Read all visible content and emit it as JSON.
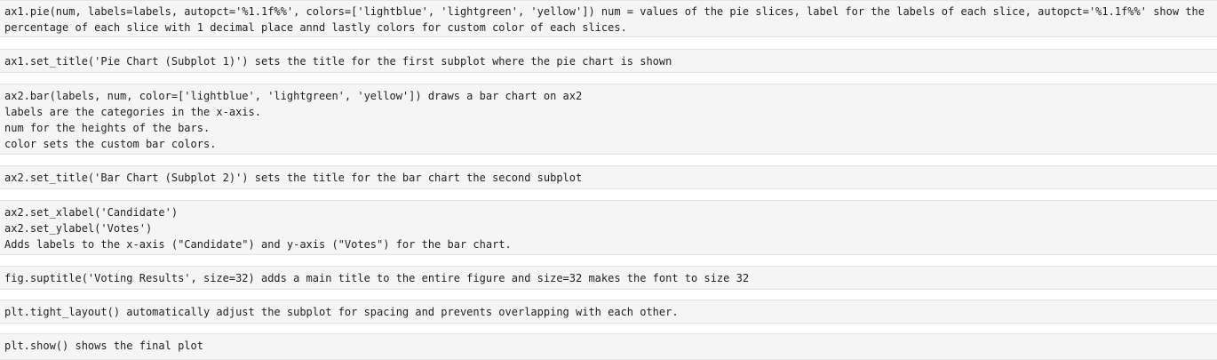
{
  "cells": [
    {
      "lines": [
        "ax1.pie(num, labels=labels, autopct='%1.1f%%', colors=['lightblue', 'lightgreen', 'yellow']) num = values of the pie slices, label for the labels of each slice, autopct='%1.1f%%' show the",
        "percentage of each slice with 1 decimal place annd lastly colors for custom color of each slices."
      ]
    },
    {
      "lines": [
        "ax1.set_title('Pie Chart (Subplot 1)') sets the title for the first subplot where the pie chart is shown"
      ]
    },
    {
      "lines": [
        "ax2.bar(labels, num, color=['lightblue', 'lightgreen', 'yellow']) draws a bar chart on ax2",
        "labels are the categories in the x-axis.",
        "num for the heights of the bars.",
        "color sets the custom bar colors."
      ]
    },
    {
      "lines": [
        "ax2.set_title('Bar Chart (Subplot 2)') sets the title for the bar chart the second subplot"
      ]
    },
    {
      "lines": [
        "ax2.set_xlabel('Candidate')",
        "ax2.set_ylabel('Votes')",
        "Adds labels to the x-axis (\"Candidate\") and y-axis (\"Votes\") for the bar chart."
      ]
    },
    {
      "lines": [
        "fig.suptitle('Voting Results', size=32) adds a main title to the entire figure and size=32 makes the font to size 32"
      ]
    },
    {
      "lines": [
        "plt.tight_layout() automatically adjust the subplot for spacing and prevents overlapping with each other."
      ]
    },
    {
      "lines": [
        "plt.show() shows the final plot"
      ]
    }
  ]
}
